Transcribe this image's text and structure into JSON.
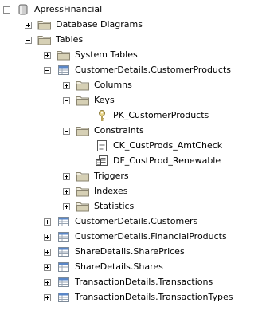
{
  "tree": {
    "root": {
      "label": "ApressFinancial"
    },
    "database_diagrams": {
      "label": "Database Diagrams"
    },
    "tables": {
      "label": "Tables"
    },
    "system_tables": {
      "label": "System Tables"
    },
    "customer_products": {
      "label": "CustomerDetails.CustomerProducts"
    },
    "columns": {
      "label": "Columns"
    },
    "keys": {
      "label": "Keys"
    },
    "pk_customer_products": {
      "label": "PK_CustomerProducts"
    },
    "constraints": {
      "label": "Constraints"
    },
    "ck_custprods_amtcheck": {
      "label": "CK_CustProds_AmtCheck"
    },
    "df_custprod_renewable": {
      "label": "DF_CustProd_Renewable"
    },
    "triggers": {
      "label": "Triggers"
    },
    "indexes": {
      "label": "Indexes"
    },
    "statistics": {
      "label": "Statistics"
    },
    "customers": {
      "label": "CustomerDetails.Customers"
    },
    "financial_products": {
      "label": "CustomerDetails.FinancialProducts"
    },
    "share_prices": {
      "label": "ShareDetails.SharePrices"
    },
    "shares": {
      "label": "ShareDetails.Shares"
    },
    "transactions": {
      "label": "TransactionDetails.Transactions"
    },
    "transaction_types": {
      "label": "TransactionDetails.TransactionTypes"
    }
  },
  "colors": {
    "folder": "#d6d0b5",
    "folder_border": "#8a8470",
    "table_header": "#5a87c8",
    "table_grid": "#9aa6b4"
  },
  "icons": {
    "database": "database-icon",
    "folder": "folder-icon",
    "table": "table-icon",
    "key": "key-icon",
    "check_constraint": "check-constraint-icon",
    "default_constraint": "default-constraint-icon"
  }
}
